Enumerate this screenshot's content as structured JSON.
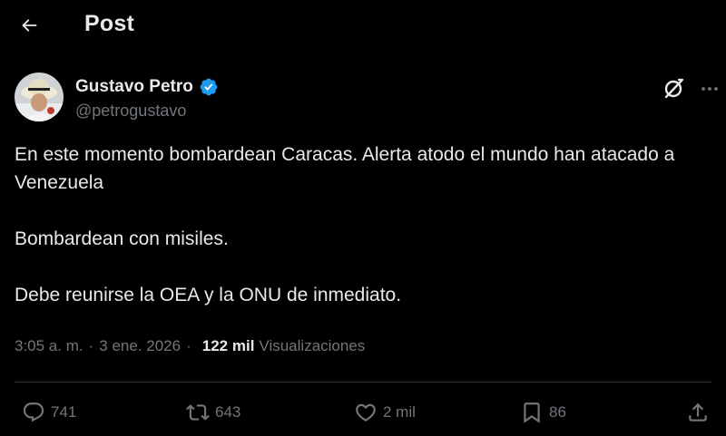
{
  "header": {
    "title": "Post",
    "back_icon": "arrow-left-icon"
  },
  "author": {
    "display_name": "Gustavo Petro",
    "handle": "@petrogustavo",
    "verified_icon": "verified-badge-icon",
    "verified_color": "#1d9bf0"
  },
  "tweet": {
    "paragraphs": [
      "En este momento bombardean Caracas. Alerta atodo el mundo han atacado a Venezuela",
      "Bombardean con misiles.",
      "Debe reunirse la OEA y la ONU de inmediato."
    ]
  },
  "meta": {
    "time": "3:05 a. m.",
    "separator": "·",
    "date": "3 ene. 2026",
    "views_count": "122 mil",
    "views_label": "Visualizaciones"
  },
  "actions": {
    "replies": "741",
    "reposts": "643",
    "likes": "2 mil",
    "bookmarks": "86"
  },
  "colors": {
    "background": "#000000",
    "text_primary": "#e7e9ea",
    "text_secondary": "#71767b",
    "divider": "#2f3336"
  }
}
